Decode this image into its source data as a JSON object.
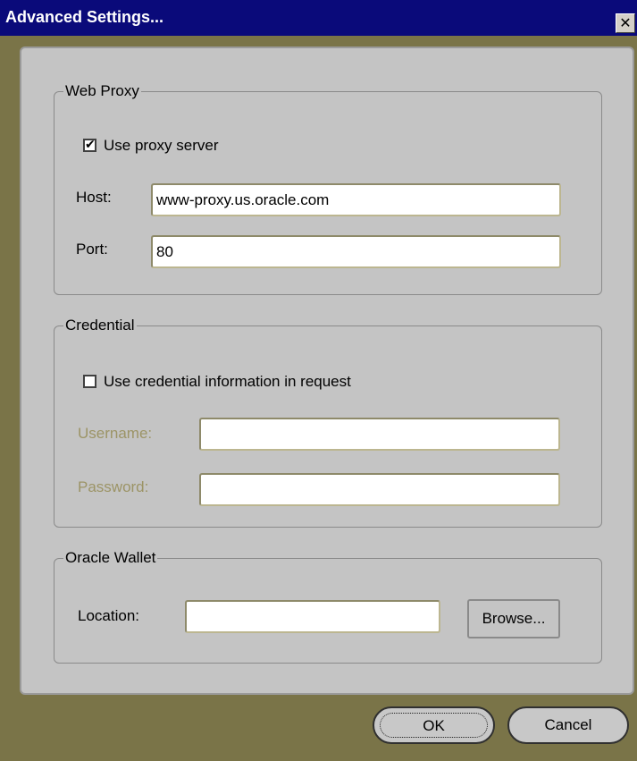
{
  "window": {
    "title": "Advanced Settings...",
    "close_glyph": "✕"
  },
  "web_proxy": {
    "legend": "Web Proxy",
    "use_proxy_label": "Use proxy server",
    "use_proxy_checked": true,
    "host_label": "Host:",
    "host_value": "www-proxy.us.oracle.com",
    "port_label": "Port:",
    "port_value": "80"
  },
  "credential": {
    "legend": "Credential",
    "use_credential_label": "Use credential information in request",
    "use_credential_checked": false,
    "username_label": "Username:",
    "username_value": "",
    "password_label": "Password:",
    "password_value": ""
  },
  "oracle_wallet": {
    "legend": "Oracle Wallet",
    "location_label": "Location:",
    "location_value": "",
    "browse_label": "Browse..."
  },
  "buttons": {
    "ok_label": "OK",
    "cancel_label": "Cancel"
  },
  "colors": {
    "titlebar": "#0a0a7a",
    "window_bg": "#7a7448",
    "panel_bg": "#c4c4c4",
    "disabled_label": "#9c9466"
  },
  "icons": {
    "close": "close-icon",
    "check": "checkmark-icon"
  }
}
